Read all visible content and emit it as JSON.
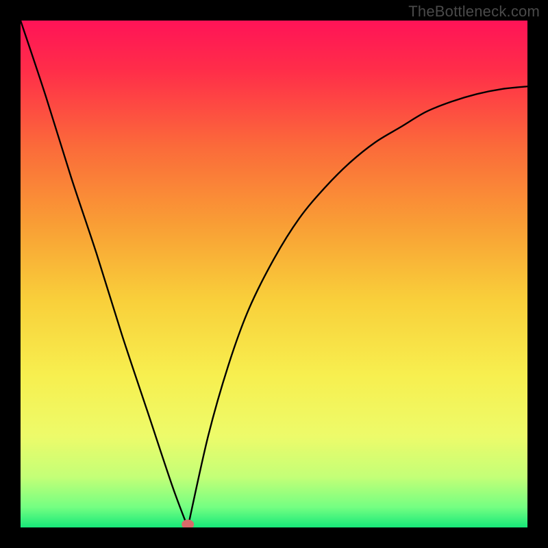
{
  "watermark": "TheBottleneck.com",
  "chart_data": {
    "type": "line",
    "title": "",
    "xlabel": "",
    "ylabel": "",
    "xlim": [
      0,
      1
    ],
    "ylim": [
      0,
      1
    ],
    "legend": false,
    "grid": false,
    "background": "gradient-red-yellow-green",
    "curves": [
      {
        "name": "left-branch",
        "x": [
          0.0,
          0.05,
          0.1,
          0.15,
          0.2,
          0.25,
          0.3,
          0.33
        ],
        "y": [
          1.0,
          0.85,
          0.69,
          0.54,
          0.38,
          0.23,
          0.08,
          0.0
        ]
      },
      {
        "name": "right-branch",
        "x": [
          0.33,
          0.37,
          0.41,
          0.45,
          0.5,
          0.55,
          0.6,
          0.65,
          0.7,
          0.75,
          0.8,
          0.85,
          0.9,
          0.95,
          1.0
        ],
        "y": [
          0.0,
          0.18,
          0.32,
          0.43,
          0.53,
          0.61,
          0.67,
          0.72,
          0.76,
          0.79,
          0.82,
          0.84,
          0.855,
          0.865,
          0.87
        ]
      }
    ],
    "marker": {
      "x": 0.33,
      "y": 0.006,
      "color": "#d86a6a"
    },
    "gradient_stops": [
      {
        "offset": 0.0,
        "color": "#ff1357"
      },
      {
        "offset": 0.1,
        "color": "#ff2e49"
      },
      {
        "offset": 0.25,
        "color": "#fb6b3a"
      },
      {
        "offset": 0.4,
        "color": "#f99d35"
      },
      {
        "offset": 0.55,
        "color": "#f9cf3a"
      },
      {
        "offset": 0.7,
        "color": "#f7ef4f"
      },
      {
        "offset": 0.82,
        "color": "#edfb6a"
      },
      {
        "offset": 0.9,
        "color": "#c4ff77"
      },
      {
        "offset": 0.96,
        "color": "#74ff82"
      },
      {
        "offset": 1.0,
        "color": "#17e879"
      }
    ]
  }
}
